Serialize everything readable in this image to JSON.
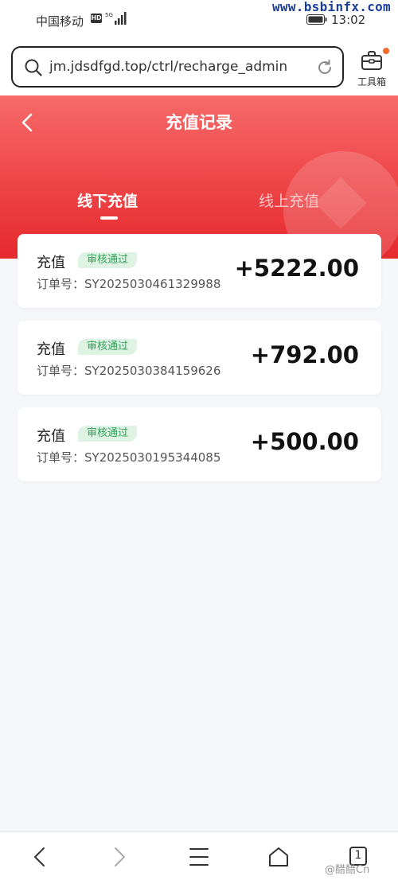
{
  "status_bar": {
    "carrier": "中国移动",
    "network_badge": "HD",
    "network_type": "5G",
    "time": "13:02",
    "watermark": "www.bsbinfx.com"
  },
  "browser": {
    "url": "jm.jdsdfgd.top/ctrl/recharge_admin",
    "toolbox_label": "工具箱"
  },
  "header": {
    "title": "充值记录",
    "tabs": [
      {
        "label": "线下充值",
        "active": true
      },
      {
        "label": "线上充值",
        "active": false
      }
    ],
    "accent_color": "#ef4446"
  },
  "records": [
    {
      "type": "充值",
      "status": "审核通过",
      "order_label": "订单号：",
      "order_no": "SY2025030461329988",
      "amount": "+5222.00"
    },
    {
      "type": "充值",
      "status": "审核通过",
      "order_label": "订单号：",
      "order_no": "SY2025030384159626",
      "amount": "+792.00"
    },
    {
      "type": "充值",
      "status": "审核通过",
      "order_label": "订单号：",
      "order_no": "SY2025030195344085",
      "amount": "+500.00"
    }
  ],
  "bottom_nav": {
    "tab_count": "1",
    "footer_mark": "@醋醋Cn"
  },
  "icons": [
    "search-icon",
    "reload-icon",
    "toolbox-icon",
    "back-icon",
    "nav-back-icon",
    "nav-forward-icon",
    "menu-icon",
    "home-icon",
    "tabs-icon"
  ]
}
